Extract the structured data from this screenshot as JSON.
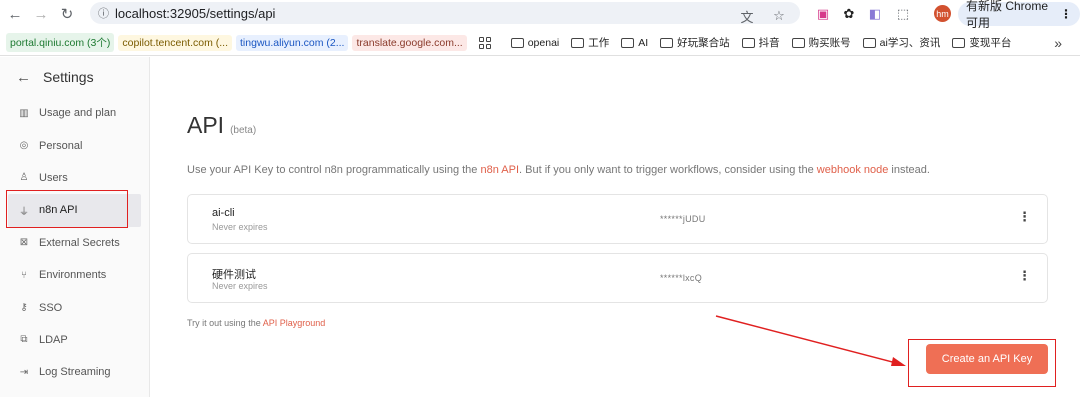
{
  "browser": {
    "url": "localhost:32905/settings/api",
    "update_button": "有新版 Chrome 可用",
    "avatar_initials": "hm",
    "bookmarks": [
      {
        "label": "portal.qiniu.com (3个)",
        "bg": "#e6f4ea",
        "color": "#1e7a32"
      },
      {
        "label": "copilot.tencent.com (...",
        "bg": "#fef7e0",
        "color": "#7a5b00"
      },
      {
        "label": "tingwu.aliyun.com (2...",
        "bg": "#e8f0fe",
        "color": "#1a56c2"
      },
      {
        "label": "translate.google.com...",
        "bg": "#fce8e6",
        "color": "#8a3a2b"
      }
    ],
    "folders": [
      "openai",
      "工作",
      "AI",
      "好玩聚合站",
      "抖音",
      "购买账号",
      "ai学习、资讯",
      "变现平台"
    ],
    "overflow": "»"
  },
  "sidebar": {
    "title": "Settings",
    "items": [
      {
        "label": "Usage and plan",
        "icon": "chart-icon",
        "glyph": "▥"
      },
      {
        "label": "Personal",
        "icon": "user-circle-icon",
        "glyph": "◎"
      },
      {
        "label": "Users",
        "icon": "user-icon",
        "glyph": "♙"
      },
      {
        "label": "n8n API",
        "icon": "plug-icon",
        "glyph": "⏚"
      },
      {
        "label": "External Secrets",
        "icon": "vault-icon",
        "glyph": "⊠"
      },
      {
        "label": "Environments",
        "icon": "branch-icon",
        "glyph": "⑂"
      },
      {
        "label": "SSO",
        "icon": "key-icon",
        "glyph": "⚷"
      },
      {
        "label": "LDAP",
        "icon": "network-icon",
        "glyph": "⧉"
      },
      {
        "label": "Log Streaming",
        "icon": "log-icon",
        "glyph": "⇥"
      }
    ],
    "active_index": 3
  },
  "main": {
    "title": "API",
    "badge": "(beta)",
    "desc_1": "Use your API Key to control n8n programmatically using the ",
    "desc_link_1": "n8n API",
    "desc_2": ". But if you only want to trigger workflows, consider using the ",
    "desc_link_2": "webhook node",
    "desc_3": " instead.",
    "keys": [
      {
        "name": "ai-cli",
        "expiry": "Never expires",
        "masked": "******jUDU"
      },
      {
        "name": "硬件测试",
        "expiry": "Never expires",
        "masked": "******lxcQ"
      }
    ],
    "tryit_prefix": "Try it out using the ",
    "tryit_link": "API Playground",
    "create_button": "Create an API Key"
  },
  "colors": {
    "accent": "#ef6f55",
    "link": "#e0604a",
    "annotation": "#e02020"
  }
}
